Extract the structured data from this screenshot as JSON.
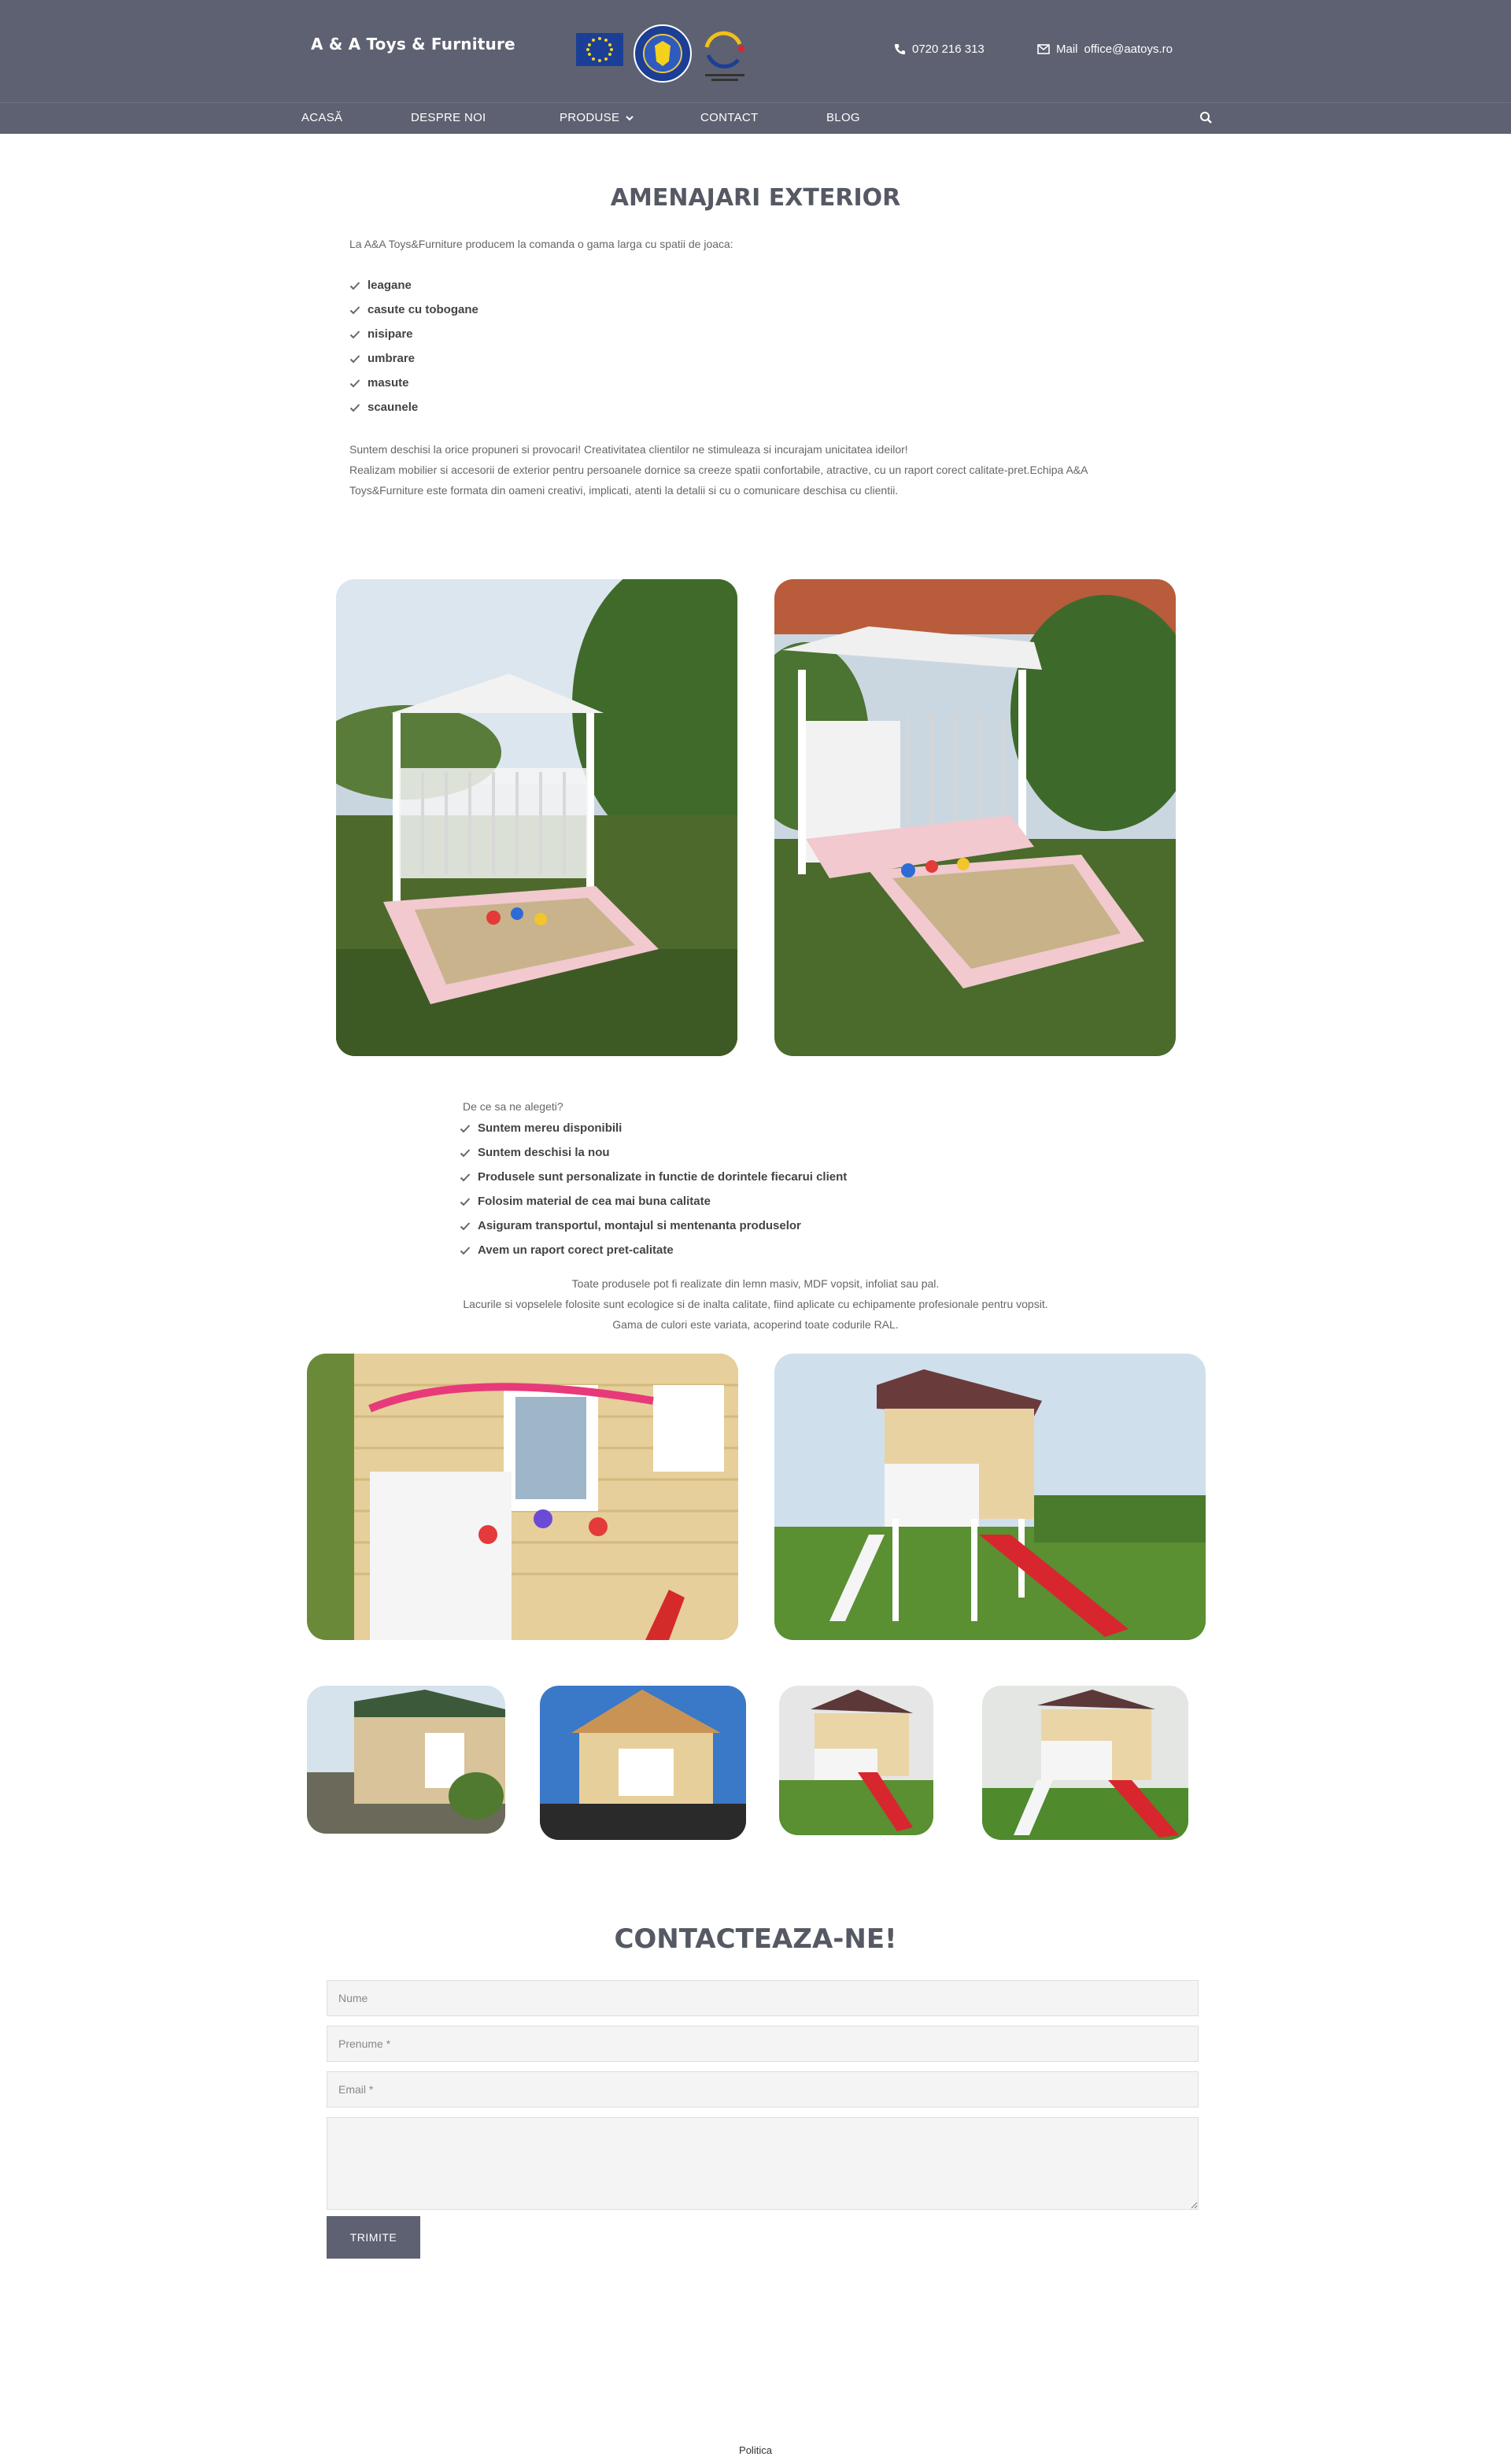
{
  "header": {
    "brand": "A & A Toys & Furniture",
    "phone": "0720 216 313",
    "mail_label": "Mail",
    "mail_address": "office@aatoys.ro"
  },
  "nav": {
    "items": [
      "ACASĂ",
      "DESPRE NOI",
      "PRODUSE",
      "CONTACT",
      "BLOG"
    ]
  },
  "main": {
    "title": "AMENAJARI EXTERIOR",
    "intro": "La A&A Toys&Furniture producem la comanda o gama larga cu spatii de joaca:",
    "products": [
      "leagane",
      "casute cu tobogane",
      "nisipare",
      "umbrare",
      "masute",
      "scaunele"
    ],
    "paragraph_lines": [
      "Suntem deschisi la orice propuneri si provocari! Creativitatea clientilor ne stimuleaza si incurajam unicitatea ideilor!",
      "Realizam mobilier si accesorii de exterior pentru persoanele dornice sa creeze spatii confortabile, atractive, cu un raport corect calitate-pret.Echipa A&A",
      "Toys&Furniture este formata din oameni creativi, implicati, atenti la detalii si cu o comunicare deschisa cu clientii."
    ],
    "why_title": "De ce sa ne alegeti?",
    "reasons": [
      "Suntem mereu disponibili",
      "Suntem deschisi la nou",
      "Produsele sunt personalizate in functie de dorintele fiecarui client",
      "Folosim material de cea mai buna calitate",
      "Asiguram transportul, montajul si mentenanta produselor",
      "Avem un raport corect pret-calitate"
    ],
    "note_lines": [
      "Toate produsele pot fi realizate din lemn masiv, MDF vopsit, infoliat sau pal.",
      "Lacurile si vopselele folosite sunt ecologice si de inalta calitate, fiind aplicate cu echipamente profesionale pentru vopsit.",
      "Gama de culori este variata, acoperind toate codurile RAL."
    ]
  },
  "form": {
    "title": "CONTACTEAZA-NE!",
    "name_placeholder": "Nume",
    "surname_placeholder": "Prenume *",
    "email_placeholder": "Email *",
    "submit_label": "TRIMITE"
  },
  "footer": {
    "link": "Politica"
  },
  "colors": {
    "header_bg": "#5e6171",
    "title": "#555964",
    "button_bg": "#5e6171"
  }
}
